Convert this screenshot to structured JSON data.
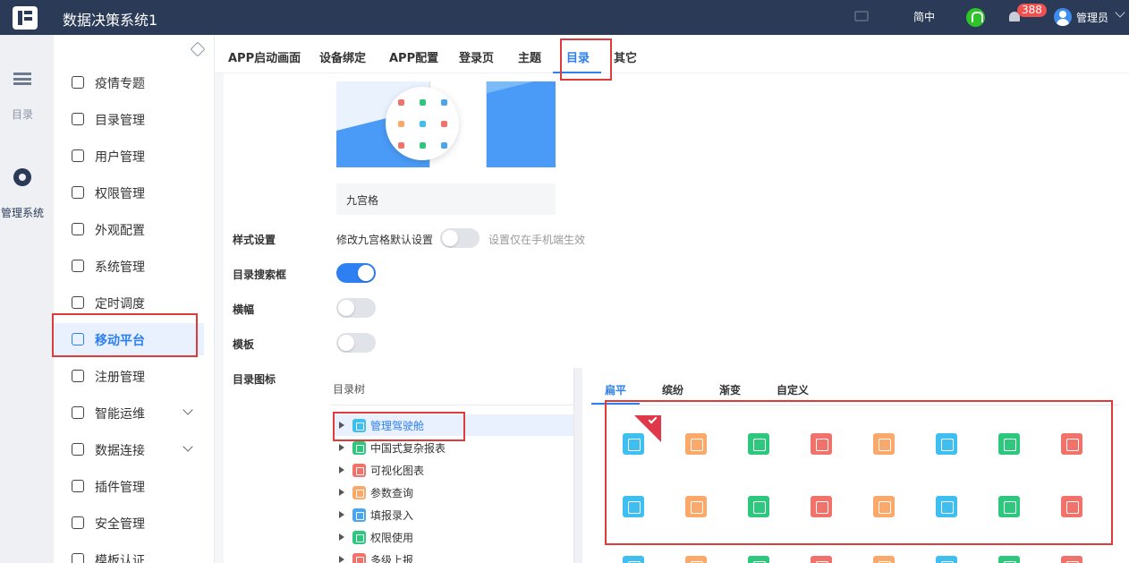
{
  "header": {
    "title": "数据决策系统1",
    "language": "简中",
    "notification_count": "388",
    "user": "管理员"
  },
  "rail": {
    "items": [
      {
        "label": "目录",
        "icon": "list-icon"
      },
      {
        "label": "管理系统",
        "icon": "gear-icon"
      }
    ]
  },
  "sidebar": {
    "items": [
      {
        "label": "疫情专题",
        "icon": "dashboard-icon"
      },
      {
        "label": "目录管理",
        "icon": "catalog-icon"
      },
      {
        "label": "用户管理",
        "icon": "user-icon"
      },
      {
        "label": "权限管理",
        "icon": "lock-icon"
      },
      {
        "label": "外观配置",
        "icon": "brush-icon"
      },
      {
        "label": "系统管理",
        "icon": "gear-icon"
      },
      {
        "label": "定时调度",
        "icon": "timer-icon"
      },
      {
        "label": "移动平台",
        "icon": "mobile-icon",
        "active": true
      },
      {
        "label": "注册管理",
        "icon": "register-icon"
      },
      {
        "label": "智能运维",
        "icon": "ops-icon",
        "expandable": true
      },
      {
        "label": "数据连接",
        "icon": "link-icon",
        "expandable": true
      },
      {
        "label": "插件管理",
        "icon": "plugin-icon"
      },
      {
        "label": "安全管理",
        "icon": "shield-icon"
      },
      {
        "label": "模板认证",
        "icon": "template-icon"
      }
    ]
  },
  "tabs": [
    "APP启动画面",
    "设备绑定",
    "APP配置",
    "登录页",
    "主题",
    "目录",
    "其它"
  ],
  "active_tab": "目录",
  "preview": {
    "caption": "九宫格"
  },
  "form": {
    "style_setting": {
      "label": "样式设置",
      "text": "修改九宫格默认设置",
      "toggle": false,
      "hint": "设置仅在手机端生效"
    },
    "search_box": {
      "label": "目录搜索框",
      "toggle": true
    },
    "banner": {
      "label": "横幅",
      "toggle": false
    },
    "template": {
      "label": "模板",
      "toggle": false
    },
    "catalog_icon": {
      "label": "目录图标"
    }
  },
  "tree": {
    "title": "目录树",
    "items": [
      {
        "label": "管理驾驶舱",
        "color": "#3ebff0",
        "selected": true
      },
      {
        "label": "中国式复杂报表",
        "color": "#2ec77e"
      },
      {
        "label": "可视化图表",
        "color": "#f0726b"
      },
      {
        "label": "参数查询",
        "color": "#fba86b"
      },
      {
        "label": "填报录入",
        "color": "#4aa6ee"
      },
      {
        "label": "权限使用",
        "color": "#2ec77e"
      },
      {
        "label": "多级上报",
        "color": "#f0726b"
      }
    ]
  },
  "icon_styles": {
    "tabs": [
      "扁平",
      "缤纷",
      "渐变",
      "自定义"
    ],
    "active": "扁平",
    "row1": [
      "#3ebff0",
      "#fba86b",
      "#2ec77e",
      "#f0726b",
      "#fba86b",
      "#3ebff0",
      "#2ec77e",
      "#f0726b"
    ],
    "row2": [
      "#3ebff0",
      "#fba86b",
      "#2ec77e",
      "#f0726b",
      "#fba86b",
      "#3ebff0",
      "#2ec77e",
      "#f0726b"
    ],
    "row3": [
      "#3ebff0",
      "#fba86b",
      "#2ec77e",
      "#f0726b",
      "#fba86b",
      "#3ebff0",
      "#2ec77e",
      "#f0726b"
    ]
  },
  "colors": {
    "accent": "#2e7ff1",
    "header_bg": "#2b3b57",
    "highlight": "#e03b3b"
  }
}
